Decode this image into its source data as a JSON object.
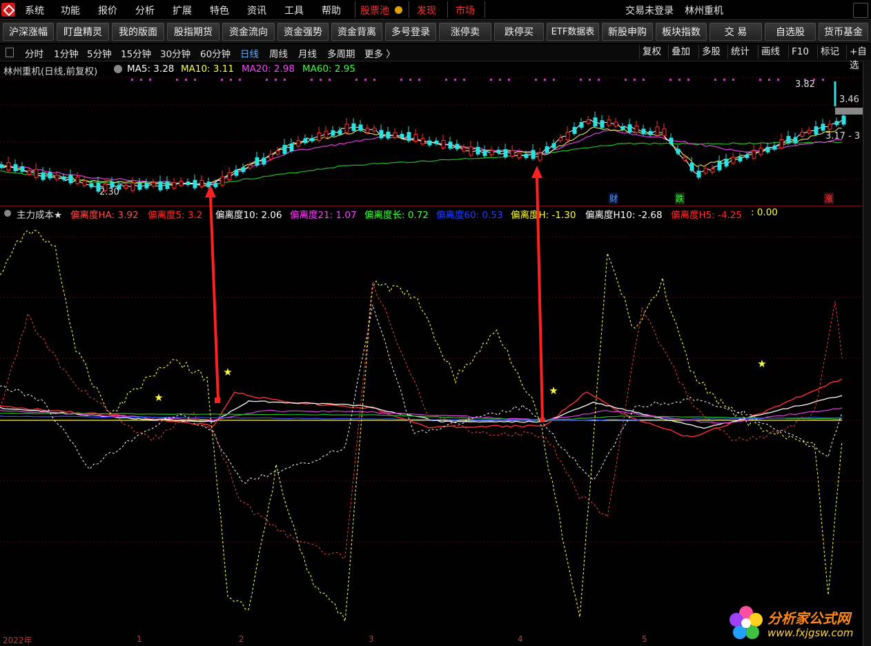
{
  "menu": {
    "items": [
      "系统",
      "功能",
      "报价",
      "分析",
      "扩展",
      "特色",
      "资讯",
      "工具",
      "帮助"
    ],
    "highlights": [
      "股票池",
      "发现",
      "市场"
    ],
    "login_status": "交易未登录",
    "stock_name": "林州重机"
  },
  "toolbar": {
    "buttons": [
      "沪深涨幅",
      "盯盘精灵",
      "我的版面",
      "股指期货",
      "资金流向",
      "资金强势",
      "资金背离",
      "多号登录",
      "涨停卖",
      "跌停买",
      "ETF数据表",
      "新股申购",
      "板块指数",
      "交  易",
      "自选股",
      "货币基金"
    ]
  },
  "periods": {
    "items": [
      "分时",
      "1分钟",
      "5分钟",
      "15分钟",
      "30分钟",
      "60分钟",
      "日线",
      "周线",
      "月线",
      "多周期",
      "更多 〉"
    ],
    "active": "日线",
    "right_tools": [
      "复权",
      "叠加",
      "多股",
      "统计",
      "画线",
      "F10",
      "标记",
      "+自选"
    ]
  },
  "main_chart": {
    "title": "林州重机(日线,前复权)",
    "ma": [
      {
        "label": "MA5: 3.28",
        "color": "#ffffff"
      },
      {
        "label": "MA10: 3.11",
        "color": "#ffff40"
      },
      {
        "label": "MA20: 2.98",
        "color": "#ff40ff"
      },
      {
        "label": "MA60: 2.95",
        "color": "#40ff40"
      }
    ],
    "price_labels": {
      "high": "3.82",
      "last": "3.46",
      "low": "2.30",
      "right": "3.17 - 3"
    },
    "event_tags": [
      {
        "text": "财",
        "color": "#4aa0ff"
      },
      {
        "text": "跌",
        "color": "#40ff40"
      },
      {
        "text": "涨",
        "color": "#ff4040"
      }
    ]
  },
  "indicator": {
    "name": "主力成本★",
    "items": [
      {
        "label": "偏离度HA: 3.92",
        "color": "#ff5050"
      },
      {
        "label": "偏离度5: 3.2",
        "color": "#ff3030"
      },
      {
        "label": "偏离度10: 2.06",
        "color": "#ffffff"
      },
      {
        "label": "偏离度21: 1.07",
        "color": "#ff40ff"
      },
      {
        "label": "偏离度长: 0.72",
        "color": "#40ff40"
      },
      {
        "label": "偏离度60: 0.53",
        "color": "#2040ff"
      },
      {
        "label": "偏离度H: -1.30",
        "color": "#ffff40"
      },
      {
        "label": "偏离度H10: -2.68",
        "color": "#ffffff"
      },
      {
        "label": "偏离度H5: -4.25",
        "color": "#ff3030"
      },
      {
        "label": ": 0.00",
        "color": "#ffff40"
      }
    ]
  },
  "date_axis": [
    "2022年",
    "1",
    "2",
    "3",
    "4",
    "5"
  ],
  "watermark": {
    "name": "分析家公式网",
    "url": "www.fxjgsw.com"
  },
  "colors": {
    "up": "#ff3030",
    "down": "#30e0e0",
    "accent": "#d01818"
  }
}
